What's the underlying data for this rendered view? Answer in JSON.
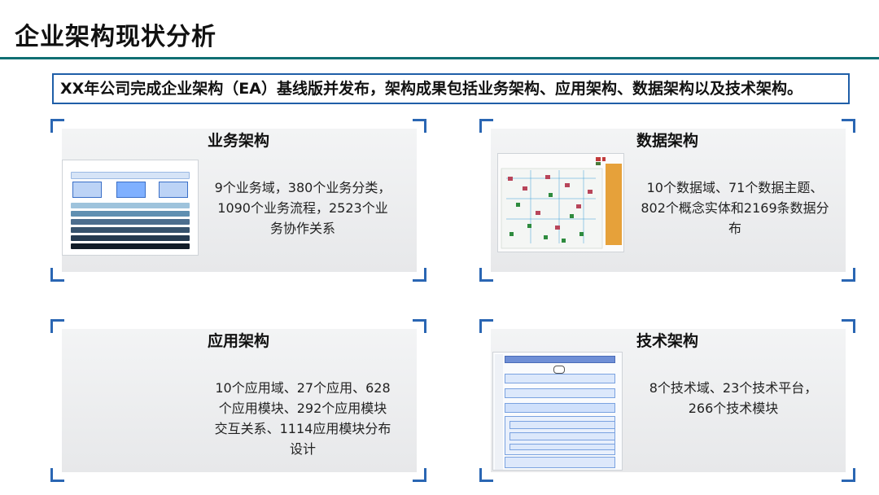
{
  "header": {
    "title": "企业架构现状分析"
  },
  "summary": "XX年公司完成企业架构（EA）基线版并发布，架构成果包括业务架构、应用架构、数据架构以及技术架构。",
  "panels": {
    "business": {
      "title": "业务架构",
      "description": "9个业务域，380个业务分类，1090个业务流程，2523个业务协作关系"
    },
    "data": {
      "title": "数据架构",
      "description": "10个数据域、71个数据主题、802个概念实体和2169条数据分布"
    },
    "application": {
      "title": "应用架构",
      "description": "10个应用域、27个应用、628个应用模块、292个应用模块交互关系、1114应用模块分布设计"
    },
    "technology": {
      "title": "技术架构",
      "description": "8个技术域、23个技术平台，266个技术模块"
    }
  },
  "colors": {
    "accent_rule": "#0f6f73",
    "frame_blue": "#2a66b3",
    "summary_border": "#1f5ea8"
  },
  "icons": {
    "business_thumbnail": "business-architecture-diagram",
    "data_thumbnail": "data-architecture-diagram",
    "technology_thumbnail": "technology-architecture-diagram"
  }
}
